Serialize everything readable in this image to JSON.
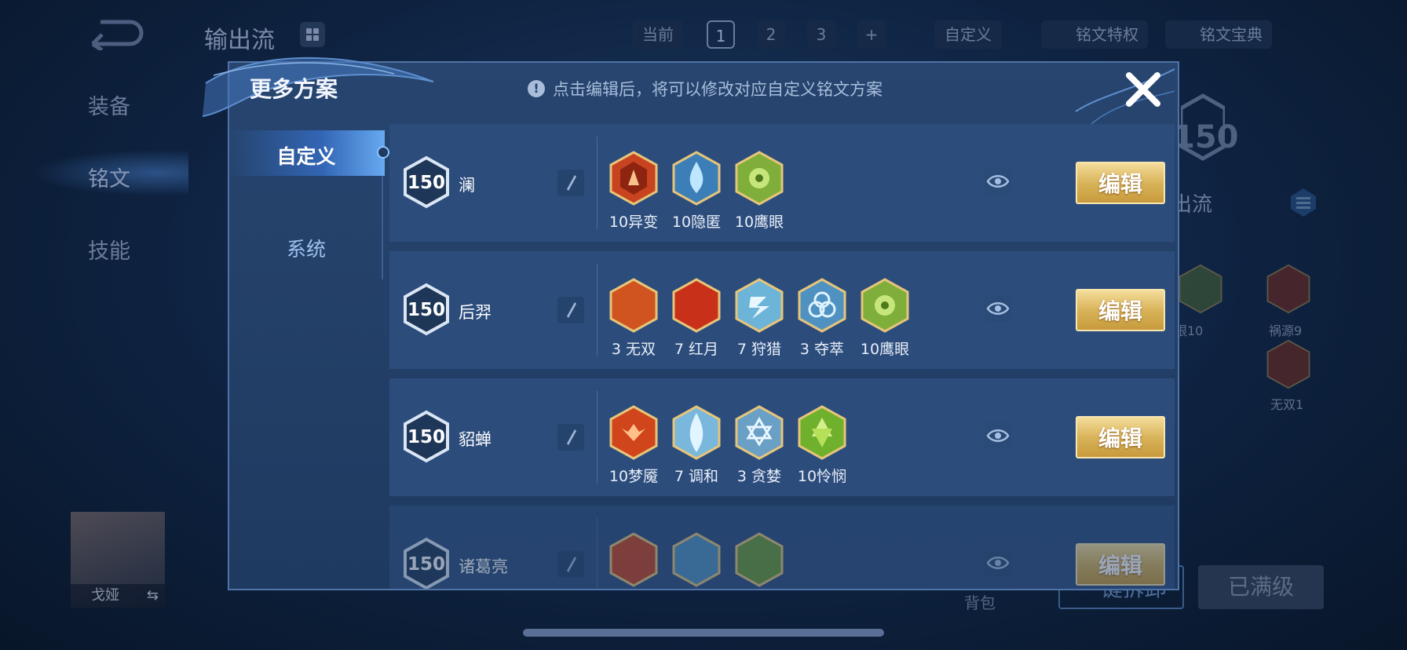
{
  "background": {
    "title": "输出流",
    "plan_label": "当前",
    "plan_tabs": [
      "1",
      "2",
      "3",
      "+"
    ],
    "custom_label": "自定义",
    "privilege_label": "铭文特权",
    "codex_label": "铭文宝典",
    "sidebar": [
      "装备",
      "铭文",
      "技能"
    ],
    "plan_level": "150",
    "plan_name": "出流",
    "runes": [
      {
        "label": "眼10"
      },
      {
        "label": "祸源9"
      },
      {
        "label": "无双1"
      }
    ],
    "hero_name": "戈娅",
    "bag_label": "背包",
    "btn_one": "键拆卸",
    "btn_max": "已满级"
  },
  "modal": {
    "title": "更多方案",
    "hint": "点击编辑后，将可以修改对应自定义铭文方案",
    "hint_icon": "!",
    "tabs": [
      {
        "label": "自定义",
        "active": true
      },
      {
        "label": "系统",
        "active": false
      }
    ],
    "edit_label": "编辑",
    "plans": [
      {
        "level": "150",
        "hero": "澜",
        "runes": [
          {
            "label": "10异变",
            "color": "red"
          },
          {
            "label": "10隐匿",
            "color": "blue"
          },
          {
            "label": "10鹰眼",
            "color": "green"
          }
        ]
      },
      {
        "level": "150",
        "hero": "后羿",
        "runes": [
          {
            "label": "3 无双",
            "color": "red"
          },
          {
            "label": "7 红月",
            "color": "red"
          },
          {
            "label": "7 狩猎",
            "color": "blue"
          },
          {
            "label": "3 夺萃",
            "color": "blue"
          },
          {
            "label": "10鹰眼",
            "color": "green"
          }
        ]
      },
      {
        "level": "150",
        "hero": "貂蝉",
        "runes": [
          {
            "label": "10梦魇",
            "color": "red"
          },
          {
            "label": "7 调和",
            "color": "blue"
          },
          {
            "label": "3 贪婪",
            "color": "blue"
          },
          {
            "label": "10怜悯",
            "color": "green"
          }
        ]
      },
      {
        "level": "150",
        "hero": "诸葛亮",
        "runes": [
          {
            "label": "",
            "color": "red"
          },
          {
            "label": "",
            "color": "blue"
          },
          {
            "label": "",
            "color": "green"
          }
        ]
      }
    ]
  },
  "colors": {
    "accent_gold": "#d9b45a",
    "rune_red": "#c8431f",
    "rune_blue": "#5aa6d8",
    "rune_green": "#7fae3a"
  }
}
